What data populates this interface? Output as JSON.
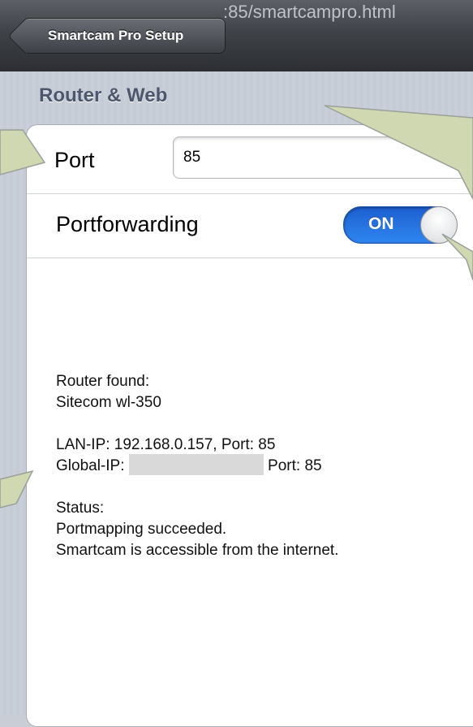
{
  "navbar": {
    "back_label": "Smartcam Pro Setup",
    "url_fragment": ":85/smartcampro.html"
  },
  "section": {
    "title": "Router & Web"
  },
  "port": {
    "label": "Port",
    "value": "85"
  },
  "portforwarding": {
    "label": "Portforwarding",
    "toggle_state": "ON"
  },
  "status": {
    "router_found_label": "Router found:",
    "router_name": "Sitecom wl-350",
    "lan_ip_line": "LAN-IP: 192.168.0.157, Port: 85",
    "global_ip_label": "Global-IP:",
    "global_ip_port": "Port: 85",
    "status_label": "Status:",
    "status_line1": "Portmapping succeeded.",
    "status_line2": "Smartcam is accessible from the internet."
  },
  "colors": {
    "toggle_on": "#2f86f0",
    "section_header": "#4c566c",
    "callout": "#cfd8b0"
  }
}
